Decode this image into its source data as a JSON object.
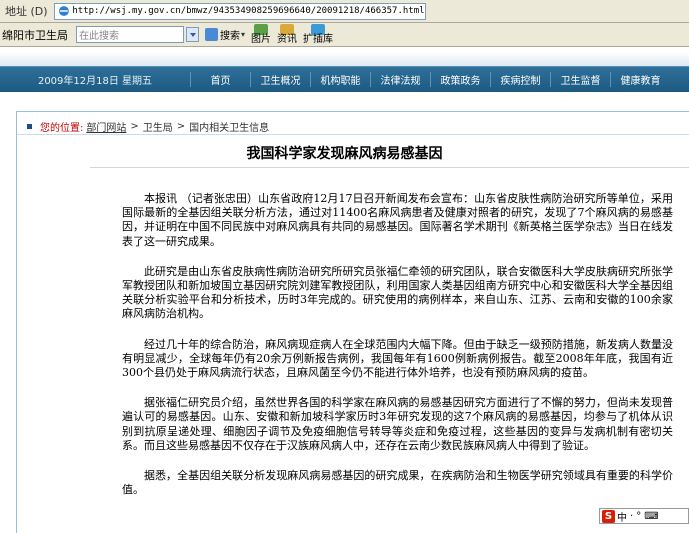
{
  "browser": {
    "address_label": "地址 (D)",
    "url": "http://wsj.my.gov.cn/bmwz/943534908259696640/20091218/466357.html"
  },
  "toolbar": {
    "site_title": "绵阳市卫生局",
    "search_placeholder": "在此搜索",
    "search_button": "搜索",
    "images_button": "图片",
    "news_button": "资讯",
    "plugins_button": "扩插库"
  },
  "nav": {
    "date": "2009年12月18日 星期五",
    "items": [
      "首页",
      "卫生概况",
      "机构职能",
      "法律法规",
      "政策政务",
      "疾病控制",
      "卫生监督",
      "健康教育"
    ]
  },
  "breadcrumb": {
    "label": "您的位置:",
    "items": [
      "部门网站",
      "卫生局",
      "国内相关卫生信息"
    ],
    "separator": ">"
  },
  "article": {
    "title": "我国科学家发现麻风病易感基因",
    "paragraphs": [
      "本报讯 （记者张忠田）山东省政府12月17日召开新闻发布会宣布：山东省皮肤性病防治研究所等单位，采用国际最新的全基因组关联分析方法，通过对11400名麻风病患者及健康对照者的研究，发现了7个麻风病的易感基因，并证明在中国不同民族中对麻风病具有共同的易感基因。国际著名学术期刊《新英格兰医学杂志》当日在线发表了这一研究成果。",
      "此研究是由山东省皮肤病性病防治研究所研究员张福仁牵领的研究团队，联合安徽医科大学皮肤病研究所张学军教授团队和新加坡国立基因研究院刘建军教授团队，利用国家人类基因组南方研究中心和安徽医科大学全基因组关联分析实验平台和分析技术，历时3年完成的。研究使用的病例样本，来自山东、江苏、云南和安徽的100余家麻风病防治机构。",
      "经过几十年的综合防治，麻风病现症病人在全球范围内大幅下降。但由于缺乏一级预防措施，新发病人数量没有明显减少，全球每年仍有20余万例新报告病例，我国每年有1600例新病例报告。截至2008年年底，我国有近300个县仍处于麻风病流行状态，且麻风菌至今仍不能进行体外培养，也没有预防麻风病的疫苗。",
      "据张福仁研究员介绍，虽然世界各国的科学家在麻风病的易感基因研究方面进行了不懈的努力，但尚未发现普遍认可的易感基因。山东、安徽和新加坡科学家历时3年研究发现的这7个麻风病的易感基因，均参与了机体从识别到抗原呈递处理、细胞因子调节及免疫细胞信号转导等炎症和免疫过程，这些基因的变异与发病机制有密切关系。而且这些易感基因不仅存在于汉族麻风病人中，还存在云南少数民族麻风病人中得到了验证。",
      "据悉，全基因组关联分析发现麻风病易感基因的研究成果，在疾病防治和生物医学研究领域具有重要的科学价值。"
    ]
  },
  "ime": {
    "label": "中"
  }
}
